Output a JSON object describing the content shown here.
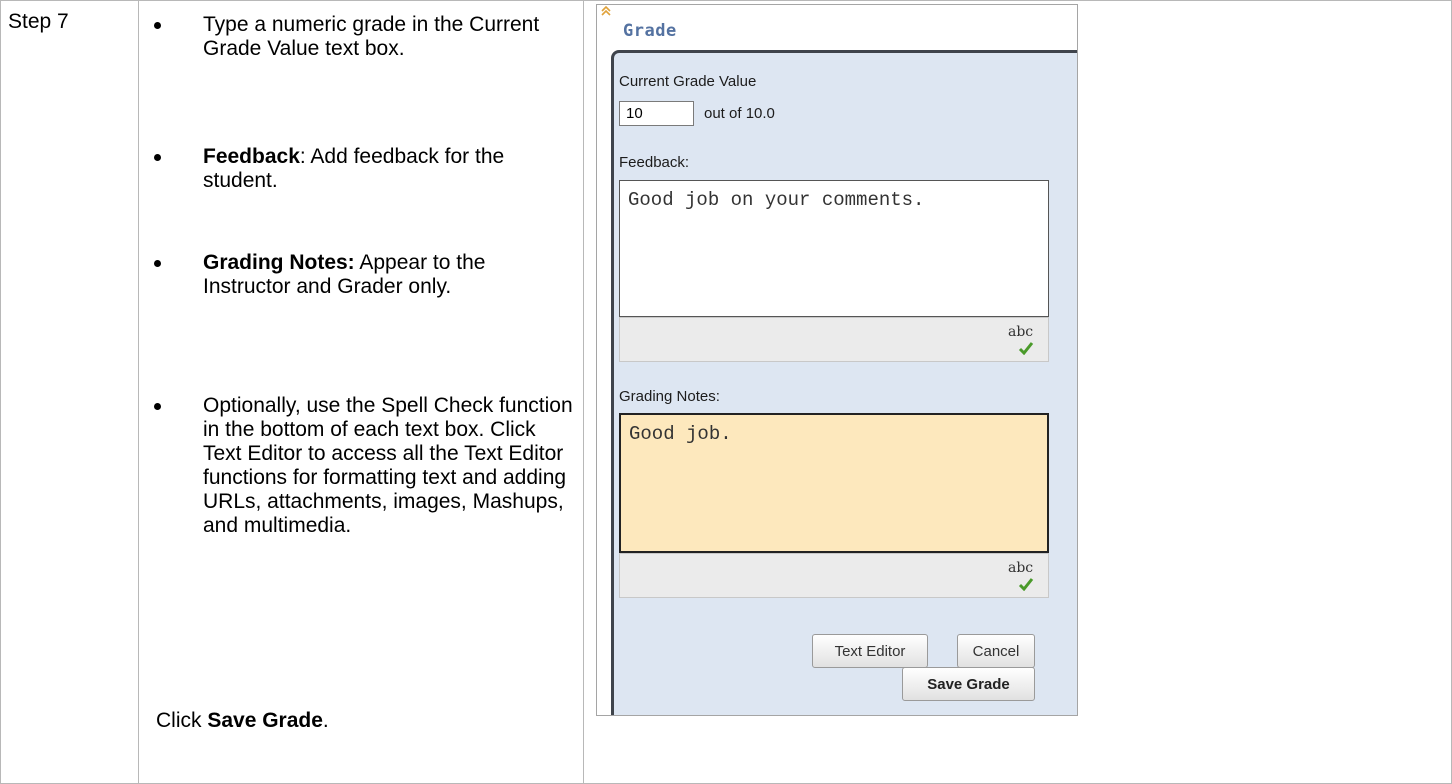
{
  "step_label": "Step 7",
  "instructions": {
    "bullet1": "Type a numeric grade in the Current Grade Value text box.",
    "bullet2_bold": "Feedback",
    "bullet2_rest": ": Add feedback for the student.",
    "bullet3_bold": "Grading Notes:",
    "bullet3_rest": " Appear to the Instructor and Grader only.",
    "bullet4": "Optionally, use the Spell Check function in the bottom of each text box. Click Text Editor to access all the Text Editor functions for formatting text and adding URLs, attachments, images, Mashups, and multimedia.",
    "click_prefix": "Click ",
    "click_bold": "Save  Grade",
    "click_suffix": "."
  },
  "panel": {
    "title": "Grade",
    "current_grade_label": "Current Grade Value",
    "grade_value": "10",
    "out_of": "out of 10.0",
    "feedback_label": "Feedback:",
    "feedback_value": "Good job on your comments.",
    "grading_notes_label": "Grading Notes:",
    "grading_notes_value": "Good job.",
    "spell_check_text": "abc",
    "text_editor_button": "Text Editor",
    "cancel_button": "Cancel",
    "save_grade_button": "Save Grade"
  },
  "colors": {
    "panel_title": "#5472a1",
    "panel_background": "#dde6f2",
    "notes_background": "#fde8bd",
    "spell_check_mark": "#4a9a2a"
  },
  "icons": [
    "collapse-arrows-icon",
    "spell-check-icon"
  ]
}
